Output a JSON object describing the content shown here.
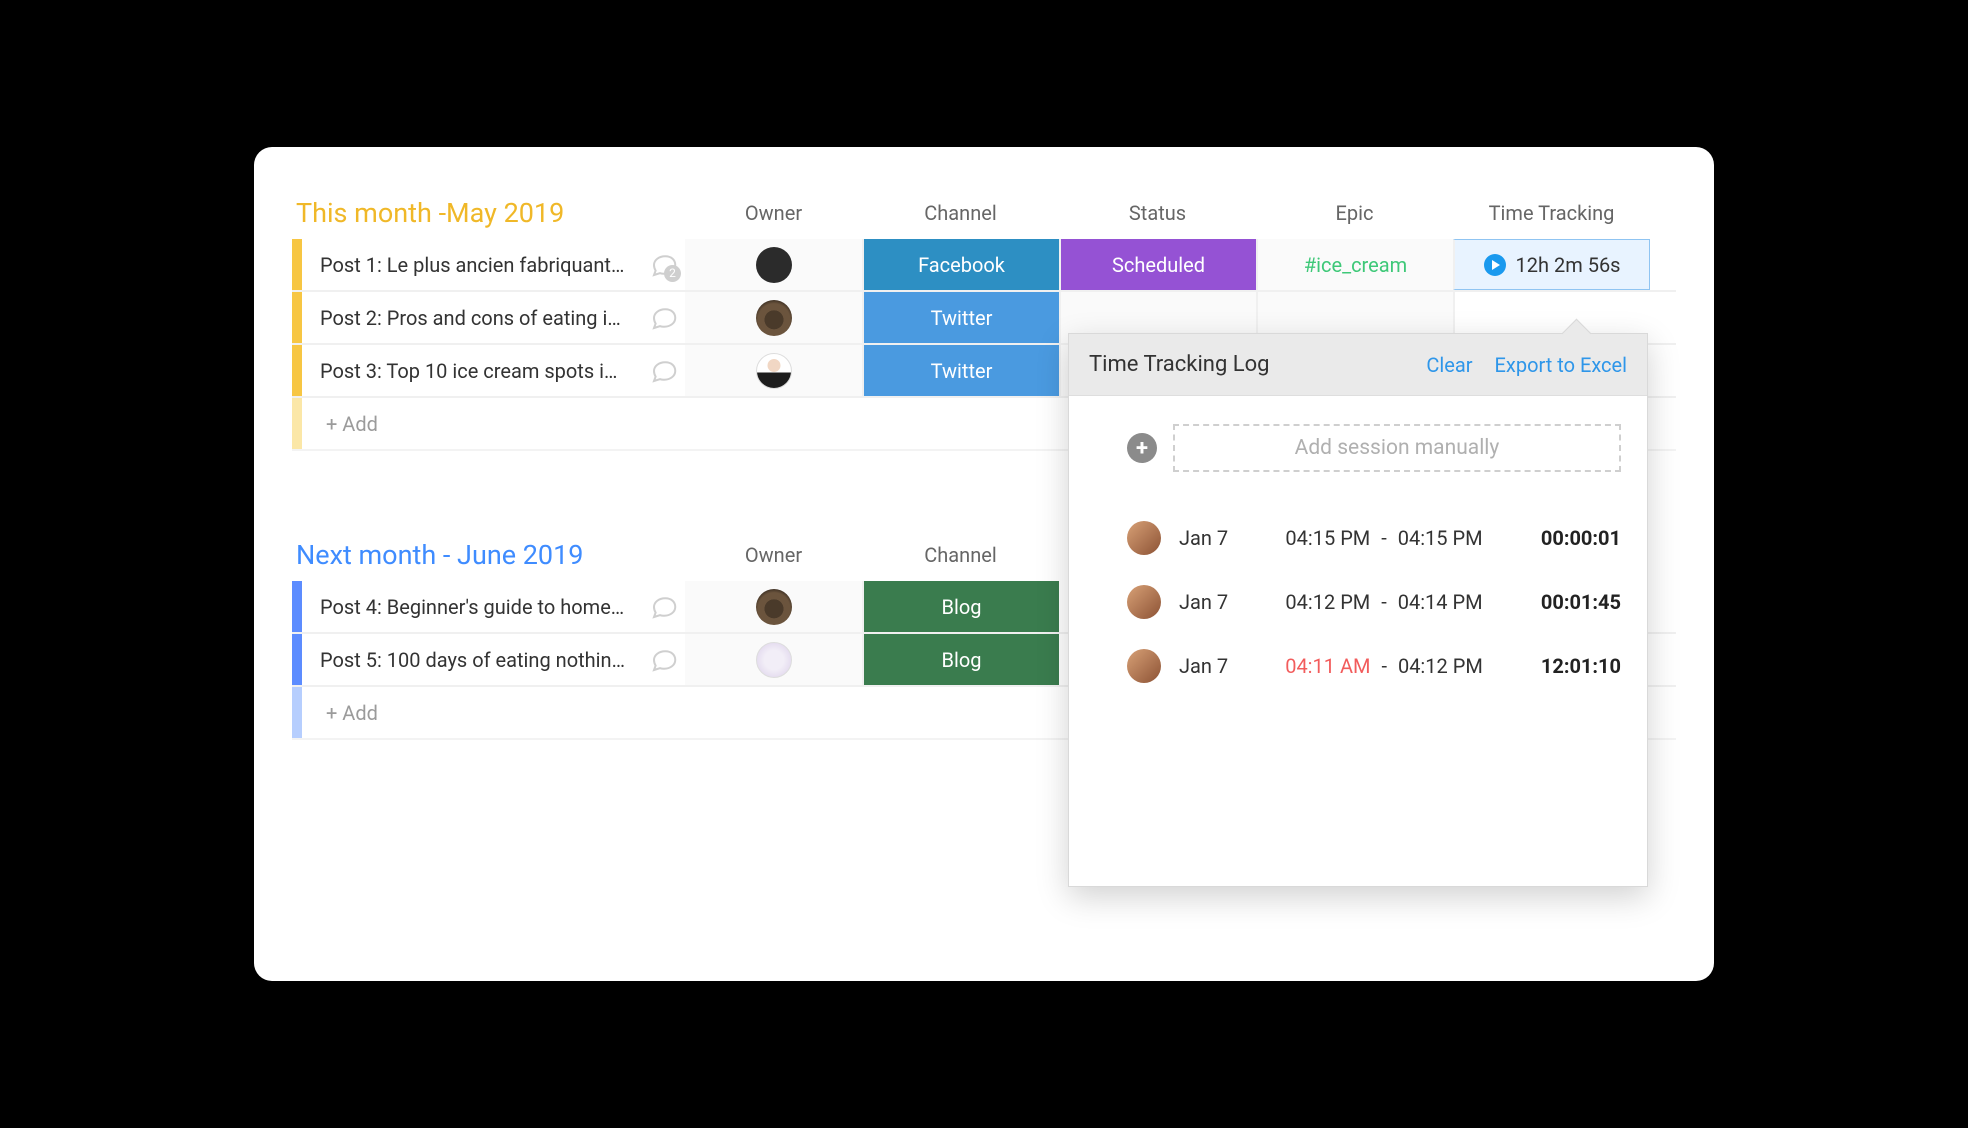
{
  "section_may": {
    "title": "This month -May 2019",
    "columns": {
      "owner": "Owner",
      "channel": "Channel",
      "status": "Status",
      "epic": "Epic",
      "track": "Time Tracking"
    },
    "rows": [
      {
        "title": "Post 1: Le plus ancien fabriquant…",
        "comment_count": "2",
        "channel": "Facebook",
        "status": "Scheduled",
        "epic": "#ice_cream",
        "track": "12h 2m 56s"
      },
      {
        "title": "Post 2: Pros and cons of eating i…",
        "channel": "Twitter"
      },
      {
        "title": "Post 3: Top 10 ice cream spots i…",
        "channel": "Twitter"
      }
    ],
    "add_label": "+ Add"
  },
  "section_june": {
    "title": "Next month - June 2019",
    "columns": {
      "owner": "Owner",
      "channel": "Channel"
    },
    "rows": [
      {
        "title": "Post 4: Beginner's guide to home…",
        "channel": "Blog"
      },
      {
        "title": "Post 5: 100 days of eating nothin…",
        "channel": "Blog"
      }
    ],
    "add_label": "+ Add"
  },
  "popover": {
    "title": "Time Tracking Log",
    "clear": "Clear",
    "export": "Export to Excel",
    "manual_label": "Add session manually",
    "sessions": [
      {
        "date": "Jan 7",
        "start": "04:15 PM",
        "end": "04:15 PM",
        "duration": "00:00:01",
        "start_alert": false
      },
      {
        "date": "Jan 7",
        "start": "04:12 PM",
        "end": "04:14 PM",
        "duration": "00:01:45",
        "start_alert": false
      },
      {
        "date": "Jan 7",
        "start": "04:11 AM",
        "end": "04:12 PM",
        "duration": "12:01:10",
        "start_alert": true
      }
    ]
  }
}
